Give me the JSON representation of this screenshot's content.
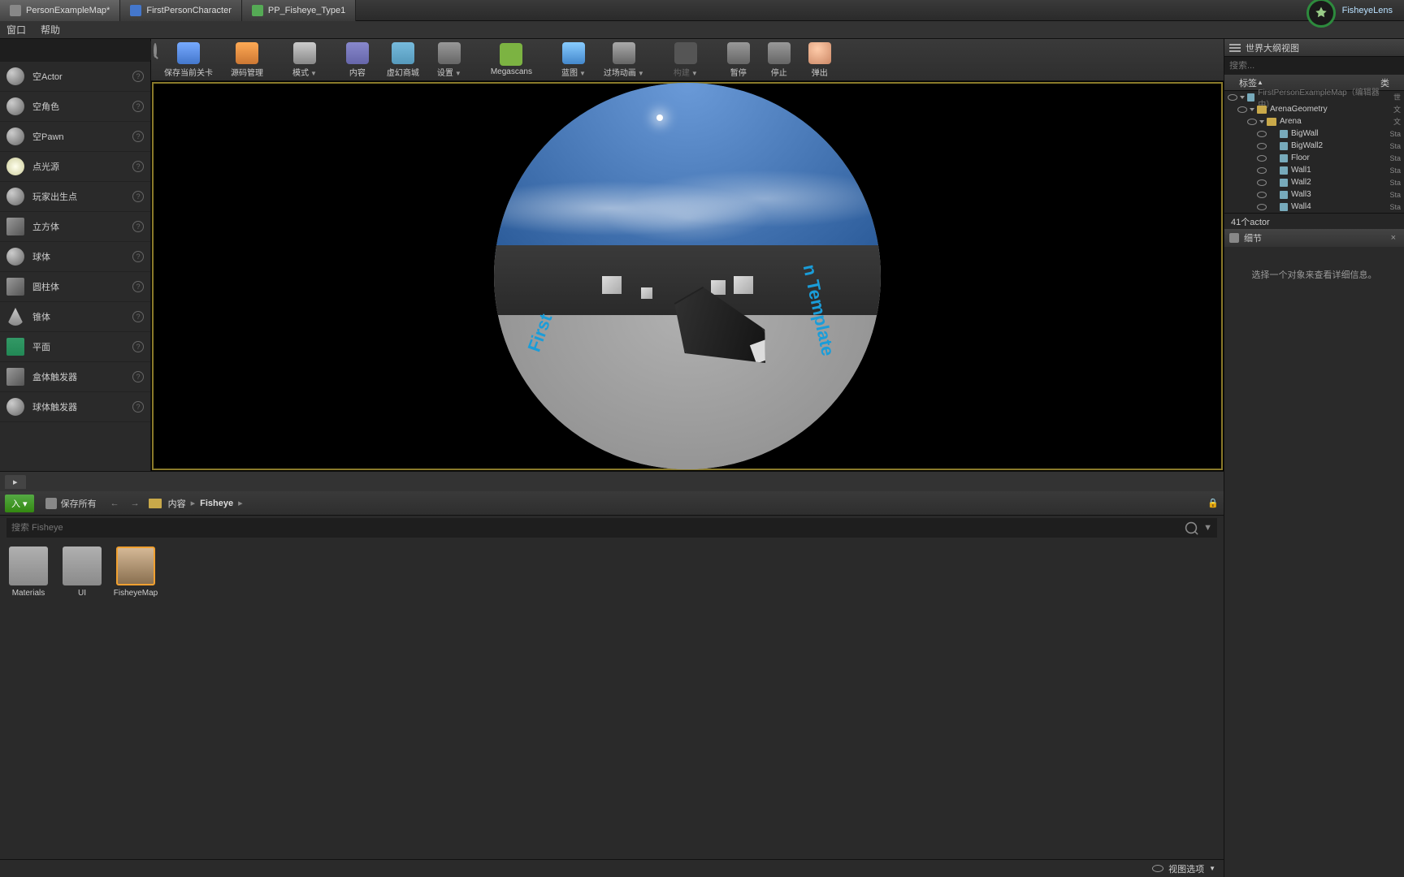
{
  "tabs": [
    {
      "label": "PersonExampleMap*",
      "active": true
    },
    {
      "label": "FirstPersonCharacter",
      "active": false
    },
    {
      "label": "PP_Fisheye_Type1",
      "active": false
    }
  ],
  "project_name": "FisheyeLens",
  "menu": {
    "window": "窗口",
    "help": "帮助"
  },
  "toolbar": {
    "save": "保存当前关卡",
    "source": "源码管理",
    "mode": "模式",
    "content": "内容",
    "market": "虚幻商城",
    "settings": "设置",
    "mega": "Megascans",
    "blueprint": "蓝图",
    "cinematic": "过场动画",
    "build": "构建",
    "pause": "暂停",
    "stop": "停止",
    "eject": "弹出"
  },
  "place_actors": {
    "items": [
      {
        "label": "空Actor",
        "icon": "sphere"
      },
      {
        "label": "空角色",
        "icon": "char"
      },
      {
        "label": "空Pawn",
        "icon": "sphere"
      },
      {
        "label": "点光源",
        "icon": "light"
      },
      {
        "label": "玩家出生点",
        "icon": "flag"
      },
      {
        "label": "立方体",
        "icon": "cube"
      },
      {
        "label": "球体",
        "icon": "sphere"
      },
      {
        "label": "圆柱体",
        "icon": "cube"
      },
      {
        "label": "锥体",
        "icon": "cone"
      },
      {
        "label": "平面",
        "icon": "plane"
      },
      {
        "label": "盒体触发器",
        "icon": "cube"
      },
      {
        "label": "球体触发器",
        "icon": "sphere"
      }
    ]
  },
  "viewport": {
    "left_text": "First",
    "right_text": "n Template"
  },
  "outliner": {
    "title": "世界大纲视图",
    "search_ph": "搜索...",
    "col_label": "标签",
    "col_type": "类",
    "rows": [
      {
        "indent": 0,
        "label": "FirstPersonExampleMap（编辑器中）",
        "type": "世",
        "dim": true,
        "folder": false,
        "open": true
      },
      {
        "indent": 1,
        "label": "ArenaGeometry",
        "type": "文",
        "dim": false,
        "folder": true,
        "open": true
      },
      {
        "indent": 2,
        "label": "Arena",
        "type": "文",
        "dim": false,
        "folder": true,
        "open": true
      },
      {
        "indent": 3,
        "label": "BigWall",
        "type": "Sta",
        "dim": false,
        "folder": false
      },
      {
        "indent": 3,
        "label": "BigWall2",
        "type": "Sta",
        "dim": false,
        "folder": false
      },
      {
        "indent": 3,
        "label": "Floor",
        "type": "Sta",
        "dim": false,
        "folder": false
      },
      {
        "indent": 3,
        "label": "Wall1",
        "type": "Sta",
        "dim": false,
        "folder": false
      },
      {
        "indent": 3,
        "label": "Wall2",
        "type": "Sta",
        "dim": false,
        "folder": false
      },
      {
        "indent": 3,
        "label": "Wall3",
        "type": "Sta",
        "dim": false,
        "folder": false
      },
      {
        "indent": 3,
        "label": "Wall4",
        "type": "Sta",
        "dim": false,
        "folder": false
      }
    ],
    "count": "41个actor"
  },
  "details": {
    "title": "细节",
    "empty": "选择一个对象来查看详细信息。"
  },
  "content_browser": {
    "add": "入 ▾",
    "save_all": "保存所有",
    "crumbs": [
      "内容",
      "Fisheye"
    ],
    "search_ph": "搜索 Fisheye",
    "assets": [
      {
        "label": "Materials",
        "type": "folder"
      },
      {
        "label": "UI",
        "type": "folder"
      },
      {
        "label": "FisheyeMap",
        "type": "map"
      }
    ],
    "view_options": "视图选项"
  }
}
